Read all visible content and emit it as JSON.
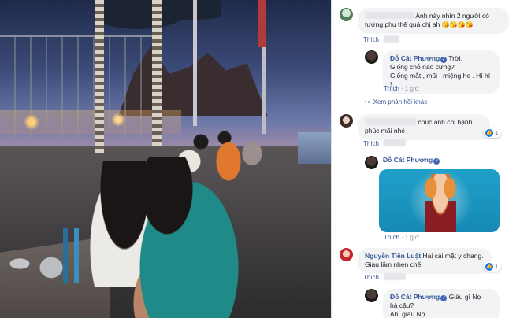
{
  "comments": [
    {
      "name_hidden": true,
      "text": "Ảnh này nhìn 2 người có tướng phu thê quá chị ah",
      "emoji": "😘😘😘😘",
      "actions": {
        "like": "Thích"
      }
    },
    {
      "name": "Đỗ Cát Phượng",
      "lines": [
        "Trời.",
        "Giống chỗ nào cưng?",
        "Giống mắt , mũi , miệng he . Hí hí !"
      ],
      "actions": {
        "like": "Thích",
        "time": "1 giờ"
      }
    },
    {
      "more_replies": "Xem phản hồi khác"
    },
    {
      "name_hidden": true,
      "text": "chúc anh chị hạnh phúc mãi nhé",
      "actions": {
        "like": "Thích"
      },
      "reactions": "1"
    },
    {
      "name": "Đỗ Cát Phượng",
      "actions": {
        "like": "Thích",
        "time": "1 giờ"
      }
    },
    {
      "name": "Nguyễn Tiến Luật",
      "text": "Hai cái mặt y chang. Giàu lắm nhen chế",
      "actions": {
        "like": "Thích"
      },
      "reactions": "1"
    },
    {
      "name": "Đỗ Cát Phượng",
      "lines": [
        "Giàu gì Nợ",
        "hả cậu?",
        "Ah, giàu Nợ ."
      ]
    }
  ],
  "colors": {
    "name": "#385898",
    "bubble": "#f2f3f5",
    "meta": "#90949c",
    "like_badge": "#1877f2"
  },
  "icons": {
    "verified": "verified-badge-icon",
    "reply_arrow": "reply-arrow-icon",
    "like": "like-thumb-icon"
  }
}
